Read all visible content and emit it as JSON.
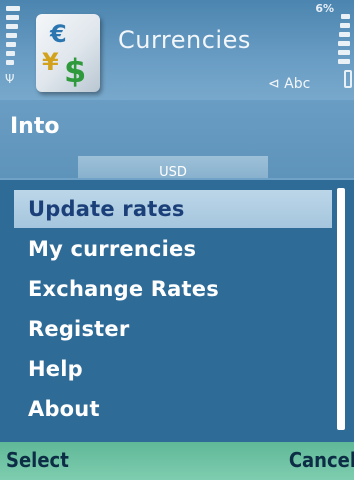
{
  "status": {
    "battery_symbol": "6%",
    "antenna": "Ψ"
  },
  "app": {
    "title": "Currencies",
    "icon": "currency-icon",
    "icon_symbols": [
      "€",
      "¥",
      "$"
    ]
  },
  "input_mode": "⊲ Abc",
  "form": {
    "label": "Into",
    "field_value": "USD"
  },
  "menu": {
    "items": [
      {
        "label": "Update rates",
        "selected": true
      },
      {
        "label": "My currencies",
        "selected": false
      },
      {
        "label": "Exchange Rates",
        "selected": false
      },
      {
        "label": "Register",
        "selected": false
      },
      {
        "label": "Help",
        "selected": false
      },
      {
        "label": "About",
        "selected": false
      }
    ]
  },
  "softkeys": {
    "left": "Select",
    "right": "Cancel"
  },
  "colors": {
    "menu_bg": "#2f6b97",
    "highlight": "#a5c6de",
    "softkey_bar": "#6fc3a3"
  }
}
